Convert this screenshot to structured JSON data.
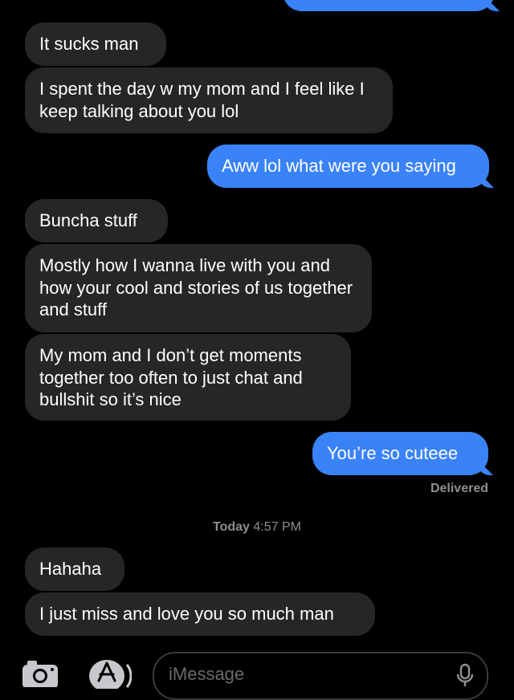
{
  "messages": [
    {
      "text": "It sucks man"
    },
    {
      "text": "I spent the day w my mom and I feel like I keep talking about you lol"
    },
    {
      "text": "Aww lol what were you saying"
    },
    {
      "text": "Buncha stuff"
    },
    {
      "text": "Mostly how I wanna live with you and how your cool and stories of us together and stuff"
    },
    {
      "text": "My mom and I don’t get moments together too often to just chat and bullshit so it’s nice"
    },
    {
      "text": "You’re so cuteee"
    },
    {
      "text": "Hahaha"
    },
    {
      "text": "I just miss and love you so much man"
    }
  ],
  "status": {
    "delivered": "Delivered"
  },
  "timestamp": {
    "day": "Today",
    "time": "4:57 PM"
  },
  "composer": {
    "placeholder": "iMessage"
  },
  "icons": {
    "camera": "camera-icon",
    "apps": "app-store-icon",
    "mic": "microphone-icon"
  },
  "colors": {
    "outgoing": "#3a82f7",
    "incoming": "#262628",
    "background": "#000000",
    "meta": "#8d8d93"
  }
}
